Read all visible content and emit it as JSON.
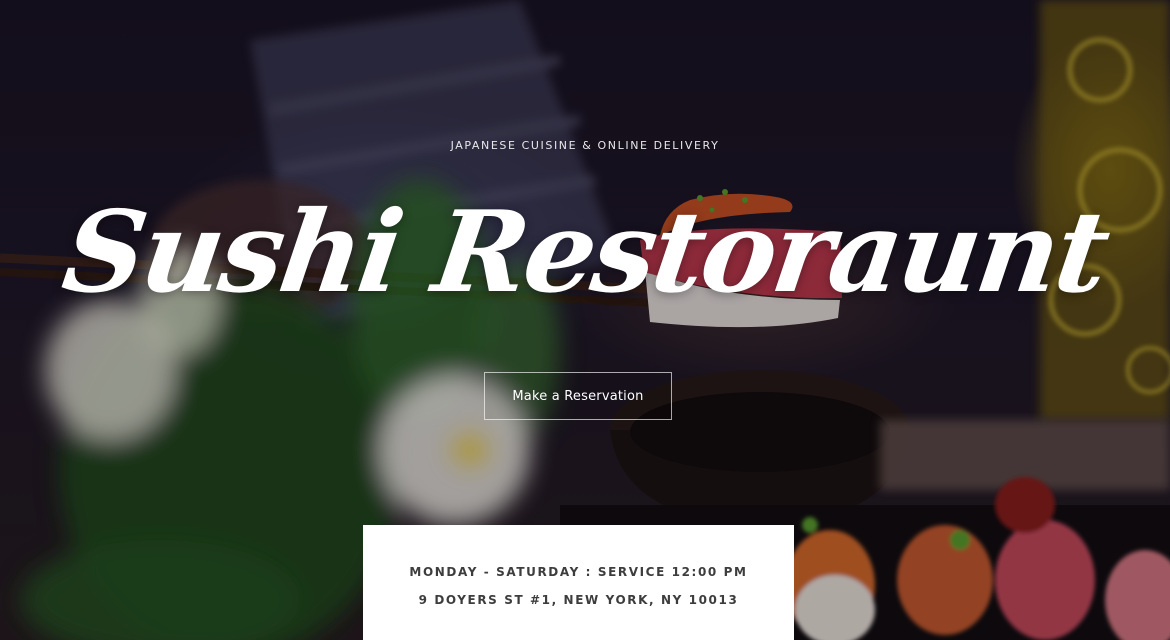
{
  "hero": {
    "tagline": "JAPANESE CUISINE & ONLINE DELIVERY",
    "title": "Sushi Restoraunt",
    "cta_label": "Make a Reservation",
    "background_description_icon": "sushi-photo-background"
  },
  "info": {
    "hours": "MONDAY - SATURDAY : SERVICE 12:00 PM",
    "address": "9 DOYERS ST #1, NEW YORK, NY 10013"
  },
  "colors": {
    "overlay": "#0a0612",
    "text": "#ffffff",
    "card_bg": "#ffffff",
    "card_text": "#3d3d3d"
  }
}
